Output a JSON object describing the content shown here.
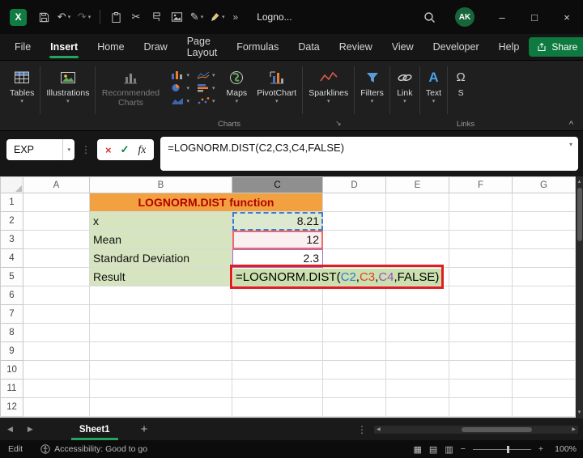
{
  "titlebar": {
    "title": "Logno...",
    "avatar_initials": "AK"
  },
  "icons": {
    "excel_logo": "X",
    "dropdown": "▾",
    "collapse_ribbon": "^",
    "more": "»",
    "undo": "↶",
    "redo": "↷",
    "cut": "✂",
    "pen": "✎",
    "close": "×",
    "minimize": "–",
    "maximize": "□",
    "cancel": "×",
    "enter_check": "✓",
    "fx": "fx",
    "dots_vertical": "⋮",
    "scroll_left": "◀",
    "scroll_right": "▶",
    "scroll_up": "▲",
    "scroll_down": "▼",
    "add": "+",
    "zoom_out": "−",
    "zoom_in": "+",
    "view_normal": "▦",
    "view_layout": "▤",
    "view_break": "▥",
    "dialog_launcher": "↘",
    "text_icon": "A",
    "symbols_icon": "Ω"
  },
  "menubar": {
    "items": [
      "File",
      "Insert",
      "Home",
      "Draw",
      "Page Layout",
      "Formulas",
      "Data",
      "Review",
      "View",
      "Developer",
      "Help"
    ],
    "active_item": "Insert",
    "share_button": "Share"
  },
  "ribbon": {
    "buttons": [
      "Tables",
      "Illustrations",
      "Recommended Charts",
      "Maps",
      "PivotChart",
      "Sparklines",
      "Filters",
      "Link",
      "Text",
      "S"
    ],
    "group_labels": [
      "Charts",
      "Links"
    ]
  },
  "formula_bar": {
    "name_box_value": "EXP",
    "formula": "=LOGNORM.DIST(C2,C3,C4,FALSE)"
  },
  "sheet": {
    "column_headers": [
      "A",
      "B",
      "C",
      "D",
      "E",
      "F",
      "G"
    ],
    "selected_column": "C",
    "row_headers": [
      "1",
      "2",
      "3",
      "4",
      "5",
      "6",
      "7",
      "8",
      "9",
      "10",
      "11",
      "12"
    ],
    "cells": {
      "b1": "LOGNORM.DIST function",
      "b2": "x",
      "c2": "8.21",
      "b3": "Mean",
      "c3": "12",
      "b4": "Standard Deviation",
      "c4": "2.3",
      "b5": "Result"
    },
    "c5_formula_parts": {
      "p1": "=LOGNORM.DIST(",
      "ref1": "C2",
      "comma1": ",",
      "ref2": "C3",
      "comma2": ",",
      "ref3": "C4",
      "p2": ",FALSE)"
    },
    "colors": {
      "title_fill": "#F2A140",
      "title_text": "#B30000",
      "label_fill": "#D7E4C0",
      "formula_fill": "#CBE0AE",
      "ref1_color": "#2E75D4",
      "ref2_color": "#E03C31",
      "ref3_color": "#9C4FC4",
      "annotation_border": "#E01E1E"
    }
  },
  "sheetbar": {
    "sheet_tab": "Sheet1"
  },
  "statusbar": {
    "mode": "Edit",
    "accessibility": "Accessibility: Good to go",
    "zoom_level": "100%"
  }
}
